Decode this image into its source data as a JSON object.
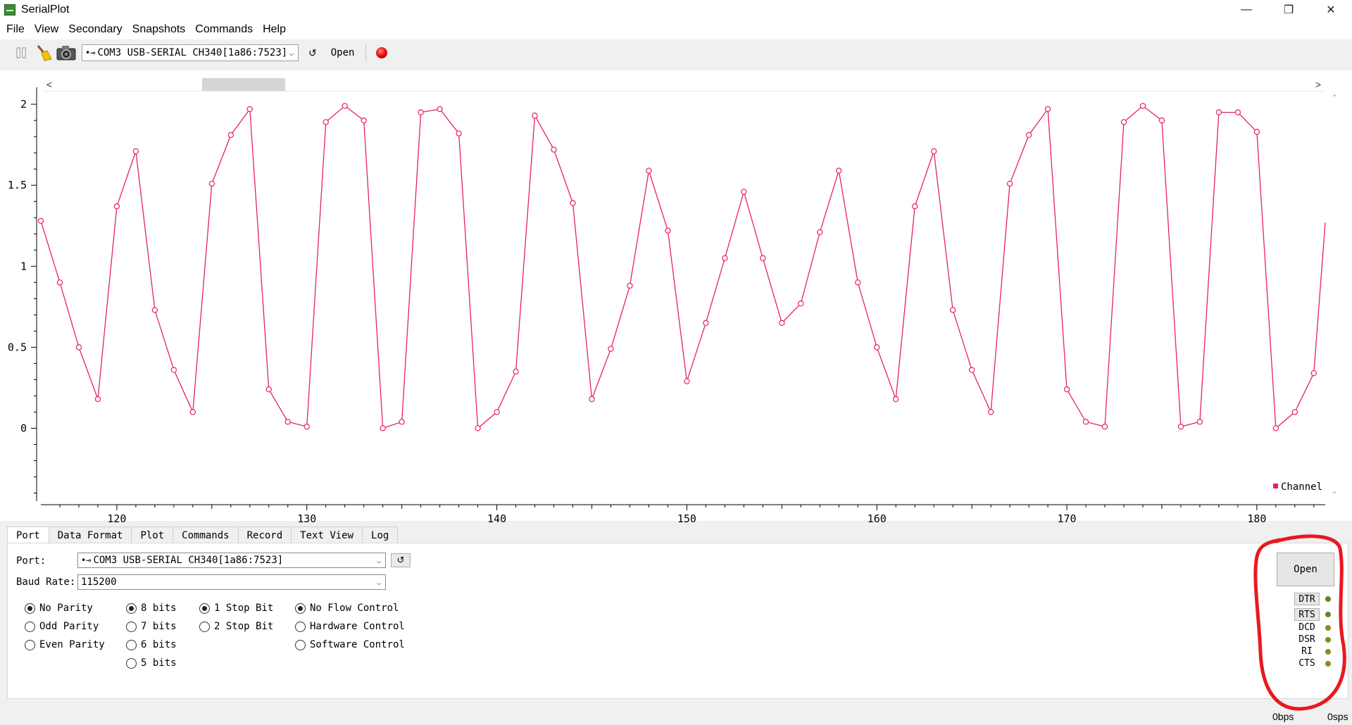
{
  "window": {
    "title": "SerialPlot"
  },
  "window_controls": {
    "minimize": "—",
    "maximize": "❐",
    "close": "✕"
  },
  "menu": [
    "File",
    "View",
    "Secondary",
    "Snapshots",
    "Commands",
    "Help"
  ],
  "toolbar": {
    "port_value": "COM3 USB-SERIAL CH340[1a86:7523]",
    "refresh_glyph": "↺",
    "open_label": "Open"
  },
  "plot": {
    "legend": "Channel",
    "line_color": "#e8225a",
    "y_ticks": [
      "2",
      "1.5",
      "1",
      "0.5",
      "0"
    ],
    "x_ticks": [
      "120",
      "130",
      "140",
      "150",
      "160",
      "170",
      "180"
    ],
    "scroll_left": "<",
    "scroll_right": ">"
  },
  "chart_data": {
    "type": "line",
    "series": [
      {
        "name": "Channel",
        "x": [
          116,
          117,
          118,
          119,
          120,
          121,
          122,
          123,
          124,
          125,
          126,
          127,
          128,
          129,
          130,
          131,
          132,
          133,
          134,
          135,
          136,
          137,
          138,
          139,
          140,
          141,
          142,
          143,
          144,
          145,
          146,
          147,
          148,
          149,
          150,
          151,
          152,
          153,
          154,
          155,
          156,
          157,
          158,
          159,
          160,
          161,
          162,
          163,
          164,
          165,
          166,
          167,
          168,
          169,
          170,
          171,
          172,
          173,
          174,
          175,
          176,
          177,
          178,
          179,
          180,
          181,
          182,
          183,
          183.6
        ],
        "values": [
          1.28,
          0.9,
          0.5,
          0.18,
          1.37,
          1.71,
          0.73,
          0.36,
          0.1,
          1.51,
          1.81,
          1.97,
          0.24,
          0.04,
          0.01,
          1.89,
          1.99,
          1.9,
          0,
          0.04,
          1.95,
          1.97,
          1.82,
          0,
          0.1,
          0.35,
          1.93,
          1.72,
          1.39,
          0.18,
          0.49,
          0.88,
          1.59,
          1.22,
          0.29,
          0.65,
          1.05,
          1.46,
          1.05,
          0.65,
          0.77,
          1.21,
          1.59,
          0.9,
          0.5,
          0.18,
          1.37,
          1.71,
          0.73,
          0.36,
          0.1,
          1.51,
          1.81,
          1.97,
          0.24,
          0.04,
          0.01,
          1.89,
          1.99,
          1.9,
          0.01,
          0.04,
          1.95,
          1.95,
          1.83,
          0,
          0.1,
          0.34,
          1.27
        ]
      }
    ],
    "xlim": [
      116,
      183.6
    ],
    "ylim": [
      -0.45,
      2.07
    ],
    "xlabel": "",
    "ylabel": "",
    "grid": false,
    "legend_position": "bottom-right"
  },
  "tabs": [
    "Port",
    "Data Format",
    "Plot",
    "Commands",
    "Record",
    "Text View",
    "Log"
  ],
  "active_tab": "Port",
  "port_tab": {
    "port_label": "Port:",
    "port_value": "COM3 USB-SERIAL CH340[1a86:7523]",
    "baud_label": "Baud Rate:",
    "baud_value": "115200",
    "refresh_glyph": "↺",
    "parity": [
      {
        "label": "No Parity",
        "checked": true
      },
      {
        "label": "Odd Parity",
        "checked": false
      },
      {
        "label": "Even Parity",
        "checked": false
      }
    ],
    "data_bits": [
      {
        "label": "8 bits",
        "checked": true
      },
      {
        "label": "7 bits",
        "checked": false
      },
      {
        "label": "6 bits",
        "checked": false
      },
      {
        "label": "5 bits",
        "checked": false
      }
    ],
    "stop_bits": [
      {
        "label": "1 Stop Bit",
        "checked": true
      },
      {
        "label": "2 Stop Bit",
        "checked": false
      }
    ],
    "flow_control": [
      {
        "label": "No Flow Control",
        "checked": true
      },
      {
        "label": "Hardware Control",
        "checked": false
      },
      {
        "label": "Software Control",
        "checked": false
      }
    ],
    "open_label": "Open",
    "signals": [
      {
        "name": "DTR",
        "button": true,
        "led_color": "#5a8a1e"
      },
      {
        "name": "RTS",
        "button": true,
        "led_color": "#5a8a1e"
      },
      {
        "name": "DCD",
        "button": false,
        "led_color": "#8a8a1e"
      },
      {
        "name": "DSR",
        "button": false,
        "led_color": "#8a8a1e"
      },
      {
        "name": "RI",
        "button": false,
        "led_color": "#8a8a1e"
      },
      {
        "name": "CTS",
        "button": false,
        "led_color": "#8a8a1e"
      }
    ]
  },
  "status": {
    "bps": "0bps",
    "sps": "0sps"
  },
  "annotation_color": "#e8191e"
}
